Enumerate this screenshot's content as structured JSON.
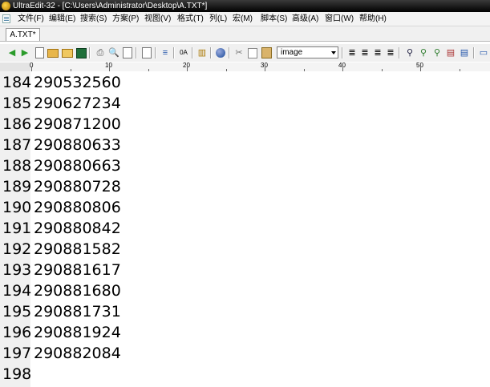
{
  "window": {
    "title": "UltraEdit-32 - [C:\\Users\\Administrator\\Desktop\\A.TXT*]"
  },
  "menu": [
    "文件(F)",
    "编辑(E)",
    "搜索(S)",
    "方案(P)",
    "视图(V)",
    "格式(T)",
    "列(L)",
    "宏(M)",
    "脚本(S)",
    "高级(A)",
    "窗口(W)",
    "帮助(H)"
  ],
  "tab": {
    "label": "A.TXT*"
  },
  "toolbar": {
    "combo_value": "image"
  },
  "ruler": {
    "labels": [
      "0",
      "10",
      "20",
      "30",
      "40",
      "50"
    ]
  },
  "lines": [
    {
      "n": "184",
      "text": "290532560"
    },
    {
      "n": "185",
      "text": "290627234"
    },
    {
      "n": "186",
      "text": "290871200"
    },
    {
      "n": "187",
      "text": "290880633"
    },
    {
      "n": "188",
      "text": "290880663"
    },
    {
      "n": "189",
      "text": "290880728"
    },
    {
      "n": "190",
      "text": "290880806"
    },
    {
      "n": "191",
      "text": "290880842"
    },
    {
      "n": "192",
      "text": "290881582"
    },
    {
      "n": "193",
      "text": "290881617"
    },
    {
      "n": "194",
      "text": "290881680"
    },
    {
      "n": "195",
      "text": "290881731"
    },
    {
      "n": "196",
      "text": "290881924"
    },
    {
      "n": "197",
      "text": "290882084"
    },
    {
      "n": "198",
      "text": ""
    }
  ]
}
